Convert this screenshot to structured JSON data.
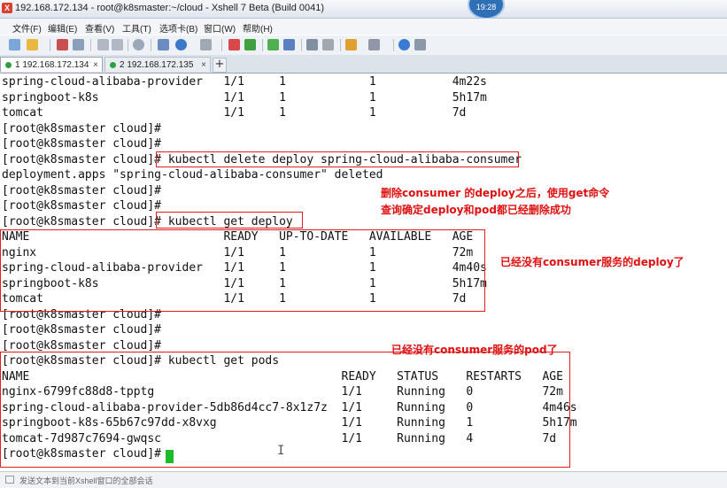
{
  "window": {
    "title": "192.168.172.134 - root@k8smaster:~/cloud - Xshell 7 Beta (Build 0041)",
    "clock": "19:28"
  },
  "menu": [
    "文件(F)",
    "编辑(E)",
    "查看(V)",
    "工具(T)",
    "选项卡(B)",
    "窗口(W)",
    "帮助(H)"
  ],
  "tabs": [
    {
      "label": "1 192.168.172.134",
      "active": true
    },
    {
      "label": "2 192.168.172.135",
      "active": false
    }
  ],
  "terminal": {
    "lines": [
      "spring-cloud-alibaba-provider   1/1     1            1           4m22s",
      "springboot-k8s                  1/1     1            1           5h17m",
      "tomcat                          1/1     1            1           7d",
      "[root@k8smaster cloud]#",
      "[root@k8smaster cloud]#",
      "[root@k8smaster cloud]# kubectl delete deploy spring-cloud-alibaba-consumer",
      "deployment.apps \"spring-cloud-alibaba-consumer\" deleted",
      "[root@k8smaster cloud]#",
      "[root@k8smaster cloud]#",
      "[root@k8smaster cloud]# kubectl get deploy",
      "NAME                            READY   UP-TO-DATE   AVAILABLE   AGE",
      "nginx                           1/1     1            1           72m",
      "spring-cloud-alibaba-provider   1/1     1            1           4m40s",
      "springboot-k8s                  1/1     1            1           5h17m",
      "tomcat                          1/1     1            1           7d",
      "[root@k8smaster cloud]#",
      "[root@k8smaster cloud]#",
      "[root@k8smaster cloud]#",
      "[root@k8smaster cloud]# kubectl get pods",
      "NAME                                             READY   STATUS    RESTARTS   AGE",
      "nginx-6799fc88d8-tpptg                           1/1     Running   0          72m",
      "spring-cloud-alibaba-provider-5db86d4cc7-8x1z7z  1/1     Running   0          4m46s",
      "springboot-k8s-65b67c97dd-x8vxg                  1/1     Running   1          5h17m",
      "tomcat-7d987c7694-gwqsc                          1/1     Running   4          7d",
      "[root@k8smaster cloud]#"
    ]
  },
  "annotations": {
    "note1_line1": "删除consumer 的deploy之后，使用get命令",
    "note1_line2": "查询确定deploy和pod都已经删除成功",
    "note2": "已经没有consumer服务的deploy了",
    "note3": "已经没有consumer服务的pod了",
    "color": "#e01010"
  },
  "statusbar": {
    "text": "发送文本到当前Xshell窗口的全部会话"
  },
  "colors": {
    "cursor": "#1dbb2b",
    "tab_dot": "#2ea043"
  }
}
